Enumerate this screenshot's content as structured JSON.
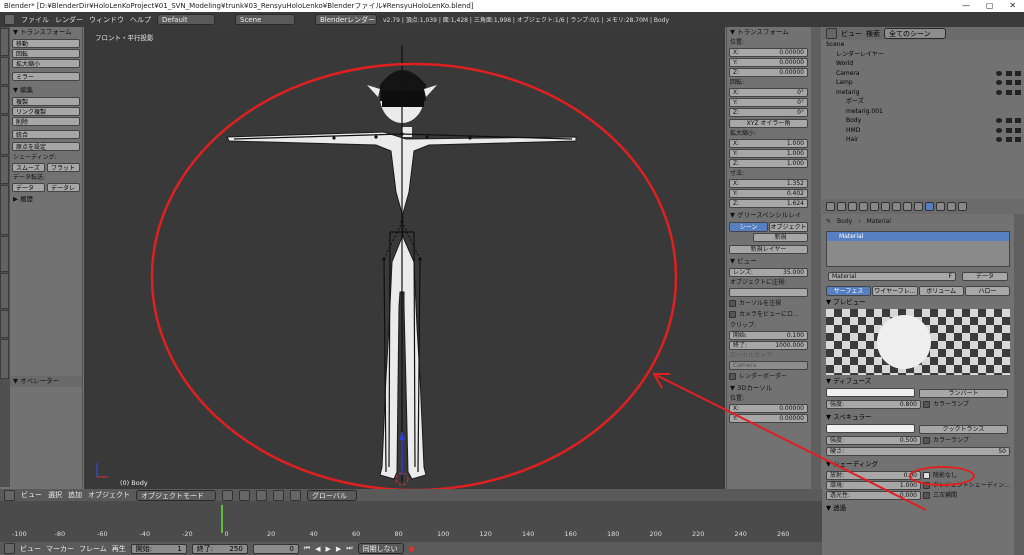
{
  "title_bar": {
    "title": "Blender* [D:¥BlenderDir¥HoloLenKoProject¥01_SVN_Modeling¥trunk¥03_RensyuHoloLenko¥Blenderファイル¥RensyuHoloLenKo.blend]",
    "minimize": "—",
    "maximize": "▢",
    "close": "✕"
  },
  "info_bar": {
    "menus": [
      "ファイル",
      "レンダー",
      "ウィンドウ",
      "ヘルプ"
    ],
    "layout": "Default",
    "scene": "Scene",
    "engine": "Blenderレンダー",
    "stats": "v2.79 | 頂点:1,039 | 面:1,428 | 三角面:1,998 | オブジェクト:1/6 | ランプ:0/1 | メモリ:28.70M | Body"
  },
  "left_tabs": [
    "ツール",
    "作成",
    "関係",
    "アニメーション",
    "物理演算",
    "グリースペンシル",
    "mmd_tools",
    "mmd_utils",
    "Misc",
    "VRM_HELPER"
  ],
  "tool_shelf": {
    "transform_header": "▼ トランスフォーム",
    "transform_buttons": [
      "移動",
      "回転",
      "拡大縮小"
    ],
    "mirror": "ミラー",
    "edit_header": "▼ 編集",
    "edit_buttons": [
      "複製",
      "リンク複製",
      "削除"
    ],
    "join": "統合",
    "origin": "原点を設定",
    "shading_label": "シェーディング:",
    "smooth": "スムーズ",
    "flat": "フラット",
    "data_transfer_label": "データ転送:",
    "data": "データ",
    "data_layer": "データレ",
    "history": "▶ 履歴",
    "operator": "▼ オペレーター"
  },
  "viewport": {
    "title": "フロント・平行投影",
    "footer": "(0) Body"
  },
  "n_panel": {
    "transform_header": "▼ トランスフォーム",
    "location_label": "位置:",
    "location": [
      {
        "axis": "X:",
        "value": "0.00000"
      },
      {
        "axis": "Y:",
        "value": "0.00000"
      },
      {
        "axis": "Z:",
        "value": "0.00000"
      }
    ],
    "rotation_label": "回転:",
    "rotation": [
      {
        "axis": "X:",
        "value": "0°"
      },
      {
        "axis": "Y:",
        "value": "0°"
      },
      {
        "axis": "Z:",
        "value": "0°"
      }
    ],
    "rotation_mode": "XYZ オイラー角",
    "scale_label": "拡大縮小:",
    "scale": [
      {
        "axis": "X:",
        "value": "1.000"
      },
      {
        "axis": "Y:",
        "value": "1.000"
      },
      {
        "axis": "Z:",
        "value": "1.000"
      }
    ],
    "dimensions_label": "寸法:",
    "dimensions": [
      {
        "axis": "X:",
        "value": "1.352"
      },
      {
        "axis": "Y:",
        "value": "0.402"
      },
      {
        "axis": "Z:",
        "value": "1.624"
      }
    ],
    "grease_header": "▼ グリースペンシルレイ",
    "scene_tab": "シーン",
    "object_tab": "オブジェクト",
    "new": "新規",
    "new_layer": "新規レイヤー",
    "view_header": "▼ ビュー",
    "lens_label": "レンズ:",
    "lens_value": "35.000",
    "lock_to_object": "オブジェクトに注視:",
    "lock_cursor": "カーソルを注視",
    "camera_to_view": "カメラをビューにロ...",
    "clip_label": "クリップ:",
    "clip_start_label": "開始:",
    "clip_start": "0.100",
    "clip_end_label": "終了:",
    "clip_end": "1000.000",
    "local_camera": "ローカルカメラ:",
    "camera": "Camera",
    "render_border": "レンダーボーダー",
    "cursor_header": "▼ 3Dカーソル",
    "cursor_label": "位置:",
    "cursor": [
      {
        "axis": "X:",
        "value": "0.00000"
      },
      {
        "axis": "Y:",
        "value": "0.00000"
      }
    ]
  },
  "outliner": {
    "header_view": "ビュー",
    "header_search": "検索",
    "filter": "全てのシーン",
    "items": [
      {
        "label": "Scene",
        "indent": 0,
        "vis": false
      },
      {
        "label": "レンダーレイヤー",
        "indent": 1,
        "vis": false
      },
      {
        "label": "World",
        "indent": 1,
        "vis": false
      },
      {
        "label": "Camera",
        "indent": 1,
        "vis": true
      },
      {
        "label": "Lamp",
        "indent": 1,
        "vis": true
      },
      {
        "label": "metarig",
        "indent": 1,
        "vis": true
      },
      {
        "label": "ポーズ",
        "indent": 2,
        "vis": false
      },
      {
        "label": "metarig.001",
        "indent": 2,
        "vis": false
      },
      {
        "label": "Body",
        "indent": 2,
        "vis": true
      },
      {
        "label": "HMD",
        "indent": 2,
        "vis": true
      },
      {
        "label": "Hair",
        "indent": 2,
        "vis": true
      }
    ]
  },
  "properties": {
    "breadcrumb_object": "Body",
    "breadcrumb_material": "Material",
    "slot": "Material",
    "material_name": "Material",
    "f": "F",
    "data_menu": "データ",
    "tabs": [
      "サーフェス",
      "ワイヤーフレ...",
      "ボリューム",
      "ハロー"
    ],
    "preview_header": "▼ プレビュー",
    "diffuse_header": "▼ ディフューズ",
    "diffuse_shader": "ランバート",
    "intensity_label": "強度:",
    "diffuse_intensity": "0.800",
    "ramp": "カラーランプ",
    "specular_header": "▼ スペキュラー",
    "specular_shader": "クックトランス",
    "specular_intensity": "0.500",
    "specular_ramp": "カラーランプ",
    "hardness_label": "硬さ:",
    "hardness": "50",
    "shading_header": "▼ シェーディング",
    "emit_label": "放射:",
    "emit": "0.00",
    "shadeless": "陰影なし",
    "ambient_label": "環境:",
    "ambient": "1.000",
    "tangent": "タンジェントシェーディン...",
    "translucency_label": "透光性:",
    "translucency": "0.000",
    "cubic": "三次補間",
    "transparency_header": "▼ 透過"
  },
  "timeline_header": {
    "menus": [
      "ビュー",
      "選択",
      "追加",
      "オブジェクト"
    ],
    "mode": "オブジェクトモード",
    "orientation": "グローバル"
  },
  "timeline": {
    "ticks": [
      "-100",
      "-80",
      "-60",
      "-40",
      "-20",
      "0",
      "20",
      "40",
      "60",
      "80",
      "100",
      "120",
      "140",
      "160",
      "180",
      "200",
      "220",
      "240",
      "260"
    ]
  },
  "timeline_footer": {
    "menus": [
      "ビュー",
      "マーカー",
      "フレーム",
      "再生"
    ],
    "start_label": "開始:",
    "start": "1",
    "end_label": "終了:",
    "end": "250",
    "current": "0",
    "sync": "同期しない"
  },
  "colors": {
    "annotation": "#e02020",
    "selected_tab": "#5680c2"
  }
}
